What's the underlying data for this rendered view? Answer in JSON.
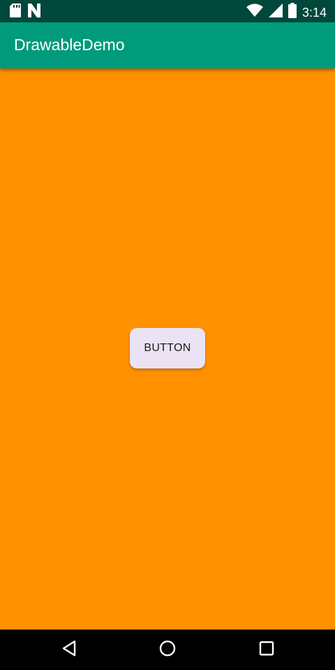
{
  "status_bar": {
    "time": "3:14",
    "icons": [
      "sd-card-icon",
      "n-notification-icon",
      "wifi-icon",
      "cellular-signal-icon",
      "battery-icon"
    ]
  },
  "app_bar": {
    "title": "DrawableDemo"
  },
  "content": {
    "button_label": "BUTTON"
  },
  "nav_bar": {
    "icons": [
      "back-icon",
      "home-icon",
      "recents-icon"
    ]
  },
  "colors": {
    "status_bar": "#00473c",
    "app_bar": "#009b7a",
    "content_background": "#ff9100",
    "button_background": "#ebe3f3",
    "nav_bar": "#000000"
  }
}
